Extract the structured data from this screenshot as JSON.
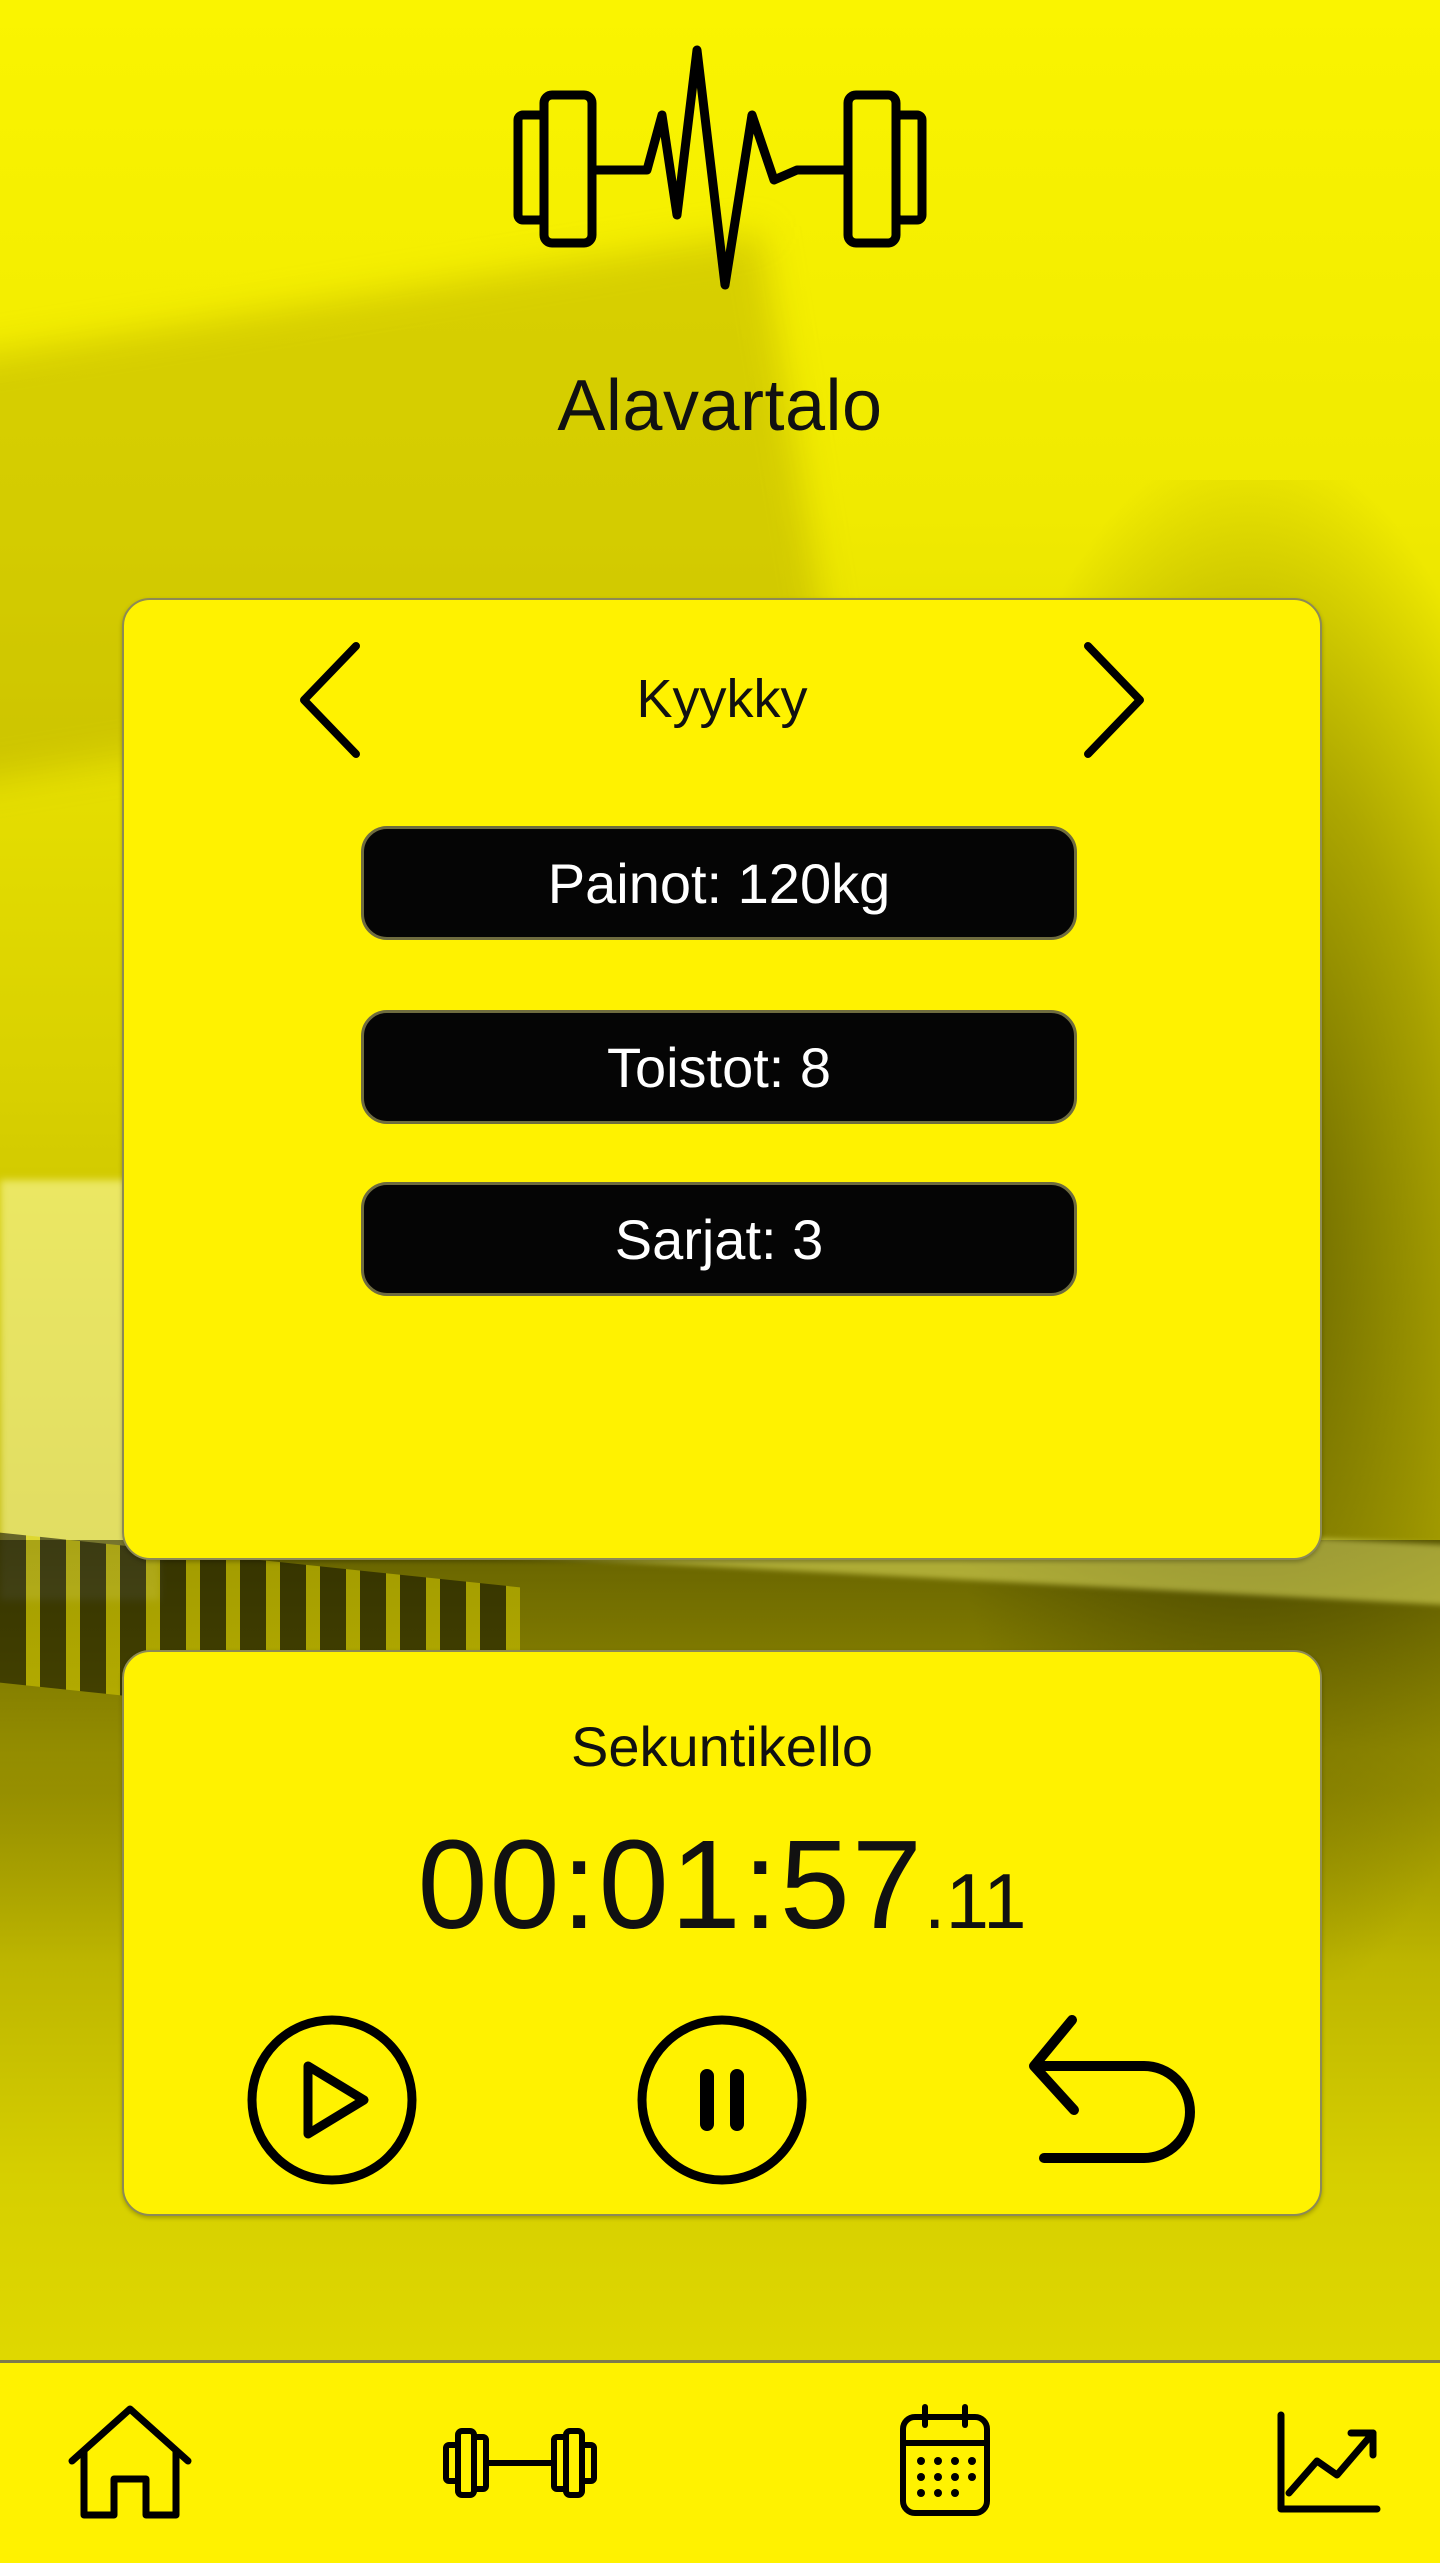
{
  "page": {
    "title": "Alavartalo"
  },
  "logo": {
    "icon": "dumbbell-heartbeat-icon"
  },
  "exercise": {
    "name": "Kyykky",
    "prev_icon": "chevron-left-icon",
    "next_icon": "chevron-right-icon",
    "weights": "Painot: 120kg",
    "reps": "Toistot: 8",
    "sets": "Sarjat: 3"
  },
  "stopwatch": {
    "title": "Sekuntikello",
    "time_main": "00:01:57",
    "time_fraction": ".11",
    "controls": [
      "play-icon",
      "pause-icon",
      "reset-icon"
    ]
  },
  "bottom_nav": {
    "items": [
      "home-icon",
      "dumbbell-icon",
      "calendar-icon",
      "chart-icon"
    ]
  },
  "colors": {
    "accent": "#fff200",
    "pill": "#050505",
    "text": "#111111"
  }
}
